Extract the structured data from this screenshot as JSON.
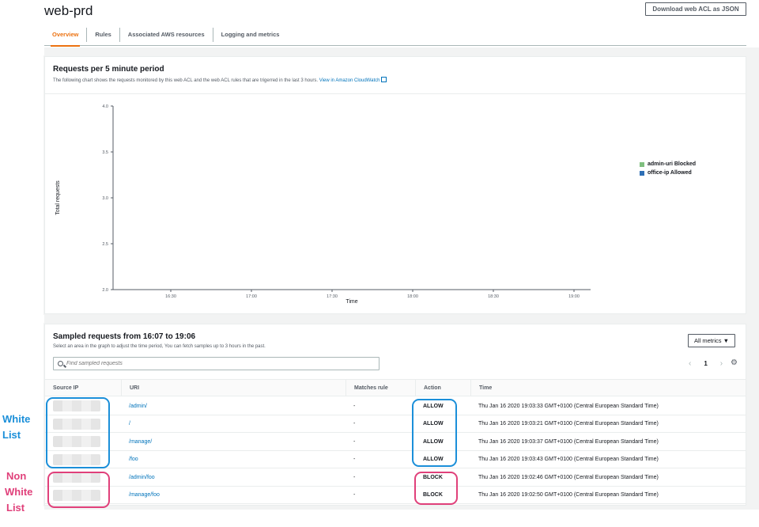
{
  "page": {
    "title": "web-prd",
    "download_label": "Download web ACL as JSON"
  },
  "tabs": [
    {
      "label": "Overview",
      "active": true
    },
    {
      "label": "Rules",
      "active": false
    },
    {
      "label": "Associated AWS resources",
      "active": false
    },
    {
      "label": "Logging and metrics",
      "active": false
    }
  ],
  "chart_panel": {
    "title": "Requests per 5 minute period",
    "description": "The following chart shows the requests monitored by this web ACL and the web ACL rules that are trigerred in the last 3 hours.",
    "link_text": "View in Amazon CloudWatch"
  },
  "chart_data": {
    "type": "line",
    "xlabel": "Time",
    "ylabel": "Total requests",
    "ylim": [
      2.0,
      4.0
    ],
    "y_ticks": [
      "2.0",
      "2.5",
      "3.0",
      "3.5",
      "4.0"
    ],
    "x_ticks": [
      "16:30",
      "17:00",
      "17:30",
      "18:00",
      "18:30",
      "19:00"
    ],
    "legend_position": "top-right",
    "series": [
      {
        "name": "admin-uri Blocked",
        "color": "#7fbf7f",
        "values": []
      },
      {
        "name": "office-ip Allowed",
        "color": "#2e6fb5",
        "values": []
      }
    ]
  },
  "sampled": {
    "title": "Sampled requests from 16:07 to 19:06",
    "description": "Select an area in the graph to adjust the time period, You can fetch samples up to 3 hours in the past.",
    "metrics_label": "All metrics ▼",
    "search_placeholder": "Find sampled requests",
    "page_number": "1",
    "columns": [
      "Source IP",
      "URI",
      "Matches rule",
      "Action",
      "Time"
    ],
    "rows": [
      {
        "uri": "/admin/",
        "rule": "-",
        "action": "ALLOW",
        "time": "Thu Jan 16 2020 19:03:33 GMT+0100 (Central European Standard Time)"
      },
      {
        "uri": "/",
        "rule": "-",
        "action": "ALLOW",
        "time": "Thu Jan 16 2020 19:03:21 GMT+0100 (Central European Standard Time)"
      },
      {
        "uri": "/manage/",
        "rule": "-",
        "action": "ALLOW",
        "time": "Thu Jan 16 2020 19:03:37 GMT+0100 (Central European Standard Time)"
      },
      {
        "uri": "/foo",
        "rule": "-",
        "action": "ALLOW",
        "time": "Thu Jan 16 2020 19:03:43 GMT+0100 (Central European Standard Time)"
      },
      {
        "uri": "/admin/foo",
        "rule": "-",
        "action": "BLOCK",
        "time": "Thu Jan 16 2020 19:02:46 GMT+0100 (Central European Standard Time)"
      },
      {
        "uri": "/manage/foo",
        "rule": "-",
        "action": "BLOCK",
        "time": "Thu Jan 16 2020 19:02:50 GMT+0100 (Central European Standard Time)"
      }
    ]
  },
  "annotations": {
    "white_list": [
      "White",
      "List"
    ],
    "non_white_list": [
      "Non",
      "White",
      "List"
    ],
    "colors": {
      "white": "#1b8fd9",
      "non": "#e0407a"
    }
  }
}
